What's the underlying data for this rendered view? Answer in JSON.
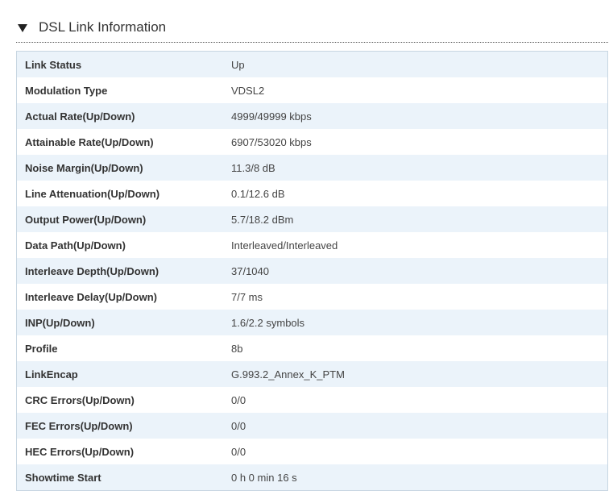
{
  "section": {
    "title": "DSL Link Information",
    "toggle_icon": "triangle-down-icon",
    "expanded": true
  },
  "rows": [
    {
      "label": "Link Status",
      "value": "Up"
    },
    {
      "label": "Modulation Type",
      "value": "VDSL2"
    },
    {
      "label": "Actual Rate(Up/Down)",
      "value": "4999/49999 kbps"
    },
    {
      "label": "Attainable Rate(Up/Down)",
      "value": "6907/53020 kbps"
    },
    {
      "label": "Noise Margin(Up/Down)",
      "value": "11.3/8 dB"
    },
    {
      "label": "Line Attenuation(Up/Down)",
      "value": "0.1/12.6 dB"
    },
    {
      "label": "Output Power(Up/Down)",
      "value": "5.7/18.2 dBm"
    },
    {
      "label": "Data Path(Up/Down)",
      "value": "Interleaved/Interleaved"
    },
    {
      "label": "Interleave Depth(Up/Down)",
      "value": "37/1040"
    },
    {
      "label": "Interleave Delay(Up/Down)",
      "value": "7/7 ms"
    },
    {
      "label": "INP(Up/Down)",
      "value": "1.6/2.2 symbols"
    },
    {
      "label": "Profile",
      "value": "8b"
    },
    {
      "label": "LinkEncap",
      "value": "G.993.2_Annex_K_PTM"
    },
    {
      "label": "CRC Errors(Up/Down)",
      "value": "0/0"
    },
    {
      "label": "FEC Errors(Up/Down)",
      "value": "0/0"
    },
    {
      "label": "HEC Errors(Up/Down)",
      "value": "0/0"
    },
    {
      "label": "Showtime Start",
      "value": "0 h 0 min 16 s"
    }
  ],
  "colors": {
    "row_alt": "#ebf3fa",
    "row": "#ffffff",
    "border": "#c8d6e2",
    "text": "#333333"
  }
}
